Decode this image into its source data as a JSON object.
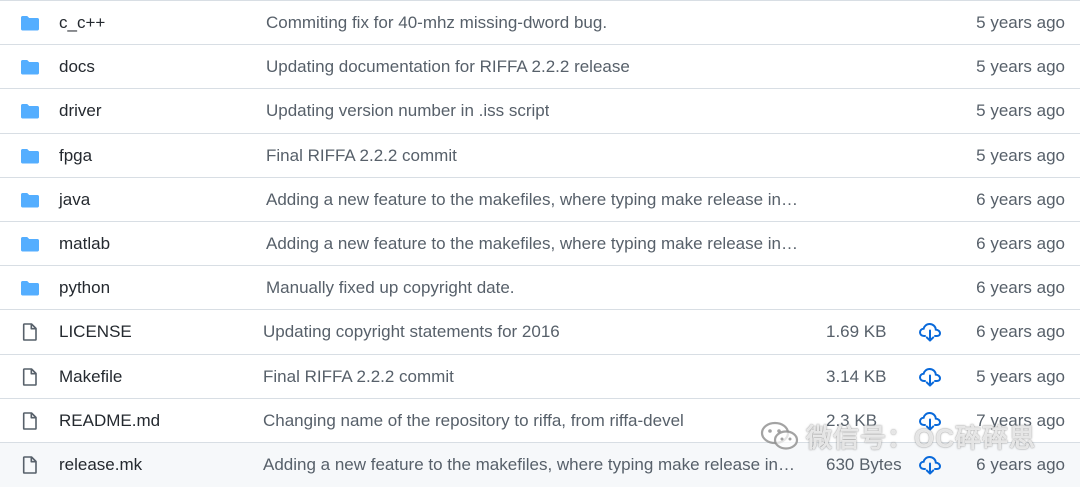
{
  "colors": {
    "folder": "#54aeff",
    "file_icon": "#57606a",
    "download": "#0969da",
    "border": "#d8dee4"
  },
  "rows": [
    {
      "type": "dir",
      "icon": "folder-icon",
      "name": "c_c++",
      "message": "Commiting fix for 40-mhz missing-dword bug.",
      "age": "5 years ago"
    },
    {
      "type": "dir",
      "icon": "folder-icon",
      "name": "docs",
      "message": "Updating documentation for RIFFA 2.2.2 release",
      "age": "5 years ago"
    },
    {
      "type": "dir",
      "icon": "folder-icon",
      "name": "driver",
      "message": "Updating version number in .iss script",
      "age": "5 years ago"
    },
    {
      "type": "dir",
      "icon": "folder-icon",
      "name": "fpga",
      "message": "Final RIFFA 2.2.2 commit",
      "age": "5 years ago"
    },
    {
      "type": "dir",
      "icon": "folder-icon",
      "name": "java",
      "message": "Adding a new feature to the makefiles, where typing make release in t…",
      "age": "6 years ago"
    },
    {
      "type": "dir",
      "icon": "folder-icon",
      "name": "matlab",
      "message": "Adding a new feature to the makefiles, where typing make release in t…",
      "age": "6 years ago"
    },
    {
      "type": "dir",
      "icon": "folder-icon",
      "name": "python",
      "message": "Manually fixed up copyright date.",
      "age": "6 years ago"
    },
    {
      "type": "file",
      "icon": "file-icon",
      "name": "LICENSE",
      "message": "Updating copyright statements for 2016",
      "size": "1.69 KB",
      "age": "6 years ago"
    },
    {
      "type": "file",
      "icon": "file-icon",
      "name": "Makefile",
      "message": "Final RIFFA 2.2.2 commit",
      "size": "3.14 KB",
      "age": "5 years ago"
    },
    {
      "type": "file",
      "icon": "file-icon",
      "name": "README.md",
      "message": "Changing name of the repository to riffa, from riffa-devel",
      "size": "2.3 KB",
      "age": "7 years ago"
    },
    {
      "type": "file",
      "icon": "file-icon",
      "name": "release.mk",
      "message": "Adding a new feature to the makefiles, where typing make release in t…",
      "size": "630 Bytes",
      "age": "6 years ago"
    }
  ],
  "watermark": {
    "icon": "wechat-icon",
    "text": "微信号：OC碎碎思"
  }
}
